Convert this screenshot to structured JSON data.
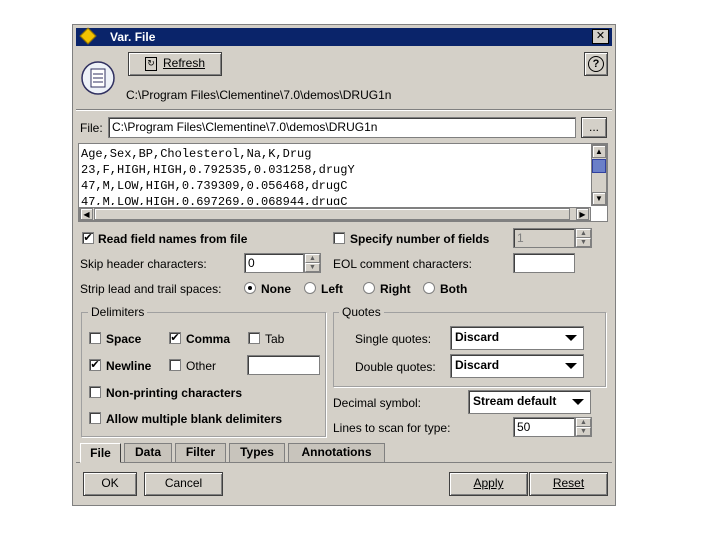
{
  "window": {
    "title": "Var. File",
    "close_glyph": "✕"
  },
  "toolbar": {
    "refresh_label": "Refresh",
    "help_glyph": "?",
    "path_display": "C:\\Program Files\\Clementine\\7.0\\demos\\DRUG1n"
  },
  "file": {
    "label": "File:",
    "value": "C:\\Program Files\\Clementine\\7.0\\demos\\DRUG1n",
    "browse_label": "..."
  },
  "preview": {
    "lines": [
      "Age,Sex,BP,Cholesterol,Na,K,Drug",
      "23,F,HIGH,HIGH,0.792535,0.031258,drugY",
      "47,M,LOW,HIGH,0.739309,0.056468,drugC",
      "47,M,LOW,HIGH,0.697269,0.068944,drugC"
    ]
  },
  "options": {
    "read_field_names": {
      "label": "Read field names from file",
      "checked": true
    },
    "specify_number": {
      "label": "Specify number of fields",
      "checked": false,
      "value": "1"
    },
    "skip_header": {
      "label": "Skip header characters:",
      "value": "0"
    },
    "eol_comment": {
      "label": "EOL comment characters:",
      "value": ""
    },
    "strip": {
      "label": "Strip lead and trail spaces:",
      "choices": [
        "None",
        "Left",
        "Right",
        "Both"
      ],
      "selected": "None"
    }
  },
  "delimiters": {
    "title": "Delimiters",
    "space": {
      "label": "Space",
      "checked": false
    },
    "comma": {
      "label": "Comma",
      "checked": true
    },
    "tab": {
      "label": "Tab",
      "checked": false
    },
    "newline": {
      "label": "Newline",
      "checked": true
    },
    "other": {
      "label": "Other",
      "checked": false,
      "value": ""
    },
    "non_printing": {
      "label": "Non-printing characters",
      "checked": false
    },
    "multiple_blank": {
      "label": "Allow multiple blank delimiters",
      "checked": false
    }
  },
  "quotes": {
    "title": "Quotes",
    "single": {
      "label": "Single quotes:",
      "value": "Discard"
    },
    "double": {
      "label": "Double quotes:",
      "value": "Discard"
    }
  },
  "decimal": {
    "label": "Decimal symbol:",
    "value": "Stream default"
  },
  "lines_scan": {
    "label": "Lines to scan for type:",
    "value": "50"
  },
  "tabs": [
    "File",
    "Data",
    "Filter",
    "Types",
    "Annotations"
  ],
  "active_tab": "File",
  "buttons": {
    "ok": "OK",
    "cancel": "Cancel",
    "apply": "Apply",
    "reset": "Reset"
  },
  "check_glyph": "✔",
  "colors": {
    "titlebar": "#0a246a",
    "face": "#d4d0c8"
  }
}
